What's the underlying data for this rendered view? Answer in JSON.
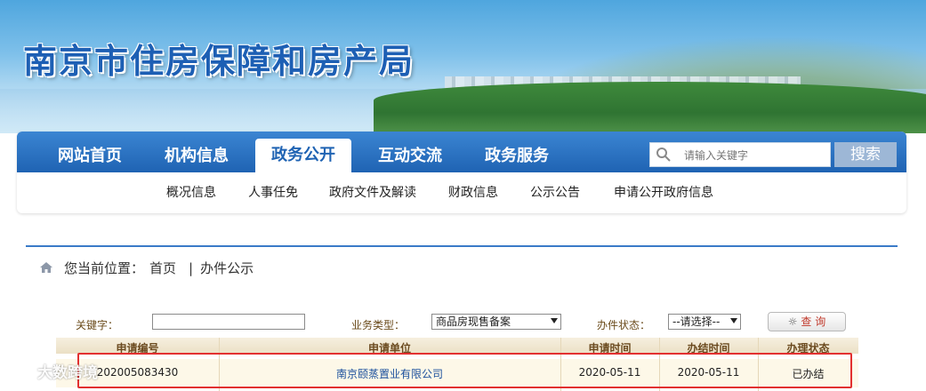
{
  "header": {
    "title": "南京市住房保障和房产局"
  },
  "nav": {
    "items": [
      {
        "label": "网站首页",
        "active": false
      },
      {
        "label": "机构信息",
        "active": false
      },
      {
        "label": "政务公开",
        "active": true
      },
      {
        "label": "互动交流",
        "active": false
      },
      {
        "label": "政务服务",
        "active": false
      }
    ],
    "search_placeholder": "请输入关键字",
    "search_button": "搜索"
  },
  "subnav": [
    "概况信息",
    "人事任免",
    "政府文件及解读",
    "财政信息",
    "公示公告",
    "申请公开政府信息"
  ],
  "breadcrumb": {
    "prefix": "您当前位置：",
    "home": "首页",
    "separator": "|",
    "current": "办件公示"
  },
  "filters": {
    "keyword_label": "关键字：",
    "keyword_value": "",
    "business_type_label": "业务类型：",
    "business_type_value": "商品房现售备案",
    "status_label": "办件状态：",
    "status_value": "--请选择--",
    "query_button": "查 询"
  },
  "table": {
    "headers": [
      "申请编号",
      "申请单位",
      "申请时间",
      "办结时间",
      "办理状态"
    ],
    "rows": [
      [
        "202005083430",
        "南京颐蒸置业有限公司",
        "2020-05-11",
        "2020-05-11",
        "已办结"
      ]
    ]
  },
  "watermark": "大数跨境",
  "colors": {
    "nav_blue": "#1f63b3",
    "highlight_red": "#e23030",
    "table_header": "#ebe0c5"
  }
}
